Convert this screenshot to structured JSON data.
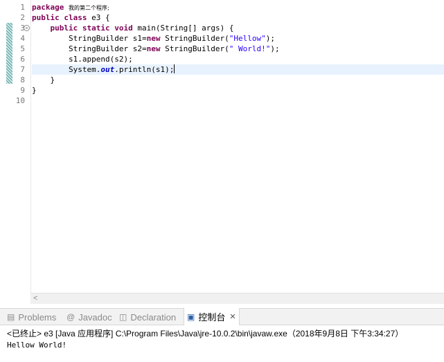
{
  "editor": {
    "line_numbers": [
      "1",
      "2",
      "3",
      "4",
      "5",
      "6",
      "7",
      "8",
      "9",
      "10"
    ],
    "lines": {
      "l1": {
        "kw": "package",
        "cn": "我的第二个程序;"
      },
      "l2": {
        "kw1": "public",
        "kw2": "class",
        "rest": "e3 {"
      },
      "l3": {
        "kw1": "public",
        "kw2": "static",
        "kw3": "void",
        "rest": "main(String[] args) {"
      },
      "l4": {
        "pre": "StringBuilder s1=",
        "kw": "new",
        "mid": "StringBuilder(",
        "str": "\"Hellow\"",
        "post": ");"
      },
      "l5": {
        "pre": "StringBuilder s2=",
        "kw": "new",
        "mid": "StringBuilder(",
        "str": "\" World!\"",
        "post": ");"
      },
      "l6": {
        "text": "s1.append(s2);"
      },
      "l7": {
        "pre": "System.",
        "fld": "out",
        "post": ".println(s1);"
      },
      "l8": {
        "text": "}"
      },
      "l9": {
        "text": "}"
      }
    }
  },
  "views": {
    "tabs": [
      {
        "label": "Problems",
        "icon": "problems-icon"
      },
      {
        "label": "Javadoc",
        "icon": "at-icon"
      },
      {
        "label": "Declaration",
        "icon": "declaration-icon"
      },
      {
        "label": "控制台",
        "icon": "console-icon"
      }
    ],
    "active_tab": 3
  },
  "console": {
    "header": "<已终止> e3 [Java 应用程序] C:\\Program Files\\Java\\jre-10.0.2\\bin\\javaw.exe（2018年9月8日 下午3:34:27）",
    "output": "Hellow World!"
  },
  "colors": {
    "keyword": "#7f0055",
    "string": "#2a00ff",
    "field": "#0000c0",
    "current_line": "#e8f2fe"
  }
}
